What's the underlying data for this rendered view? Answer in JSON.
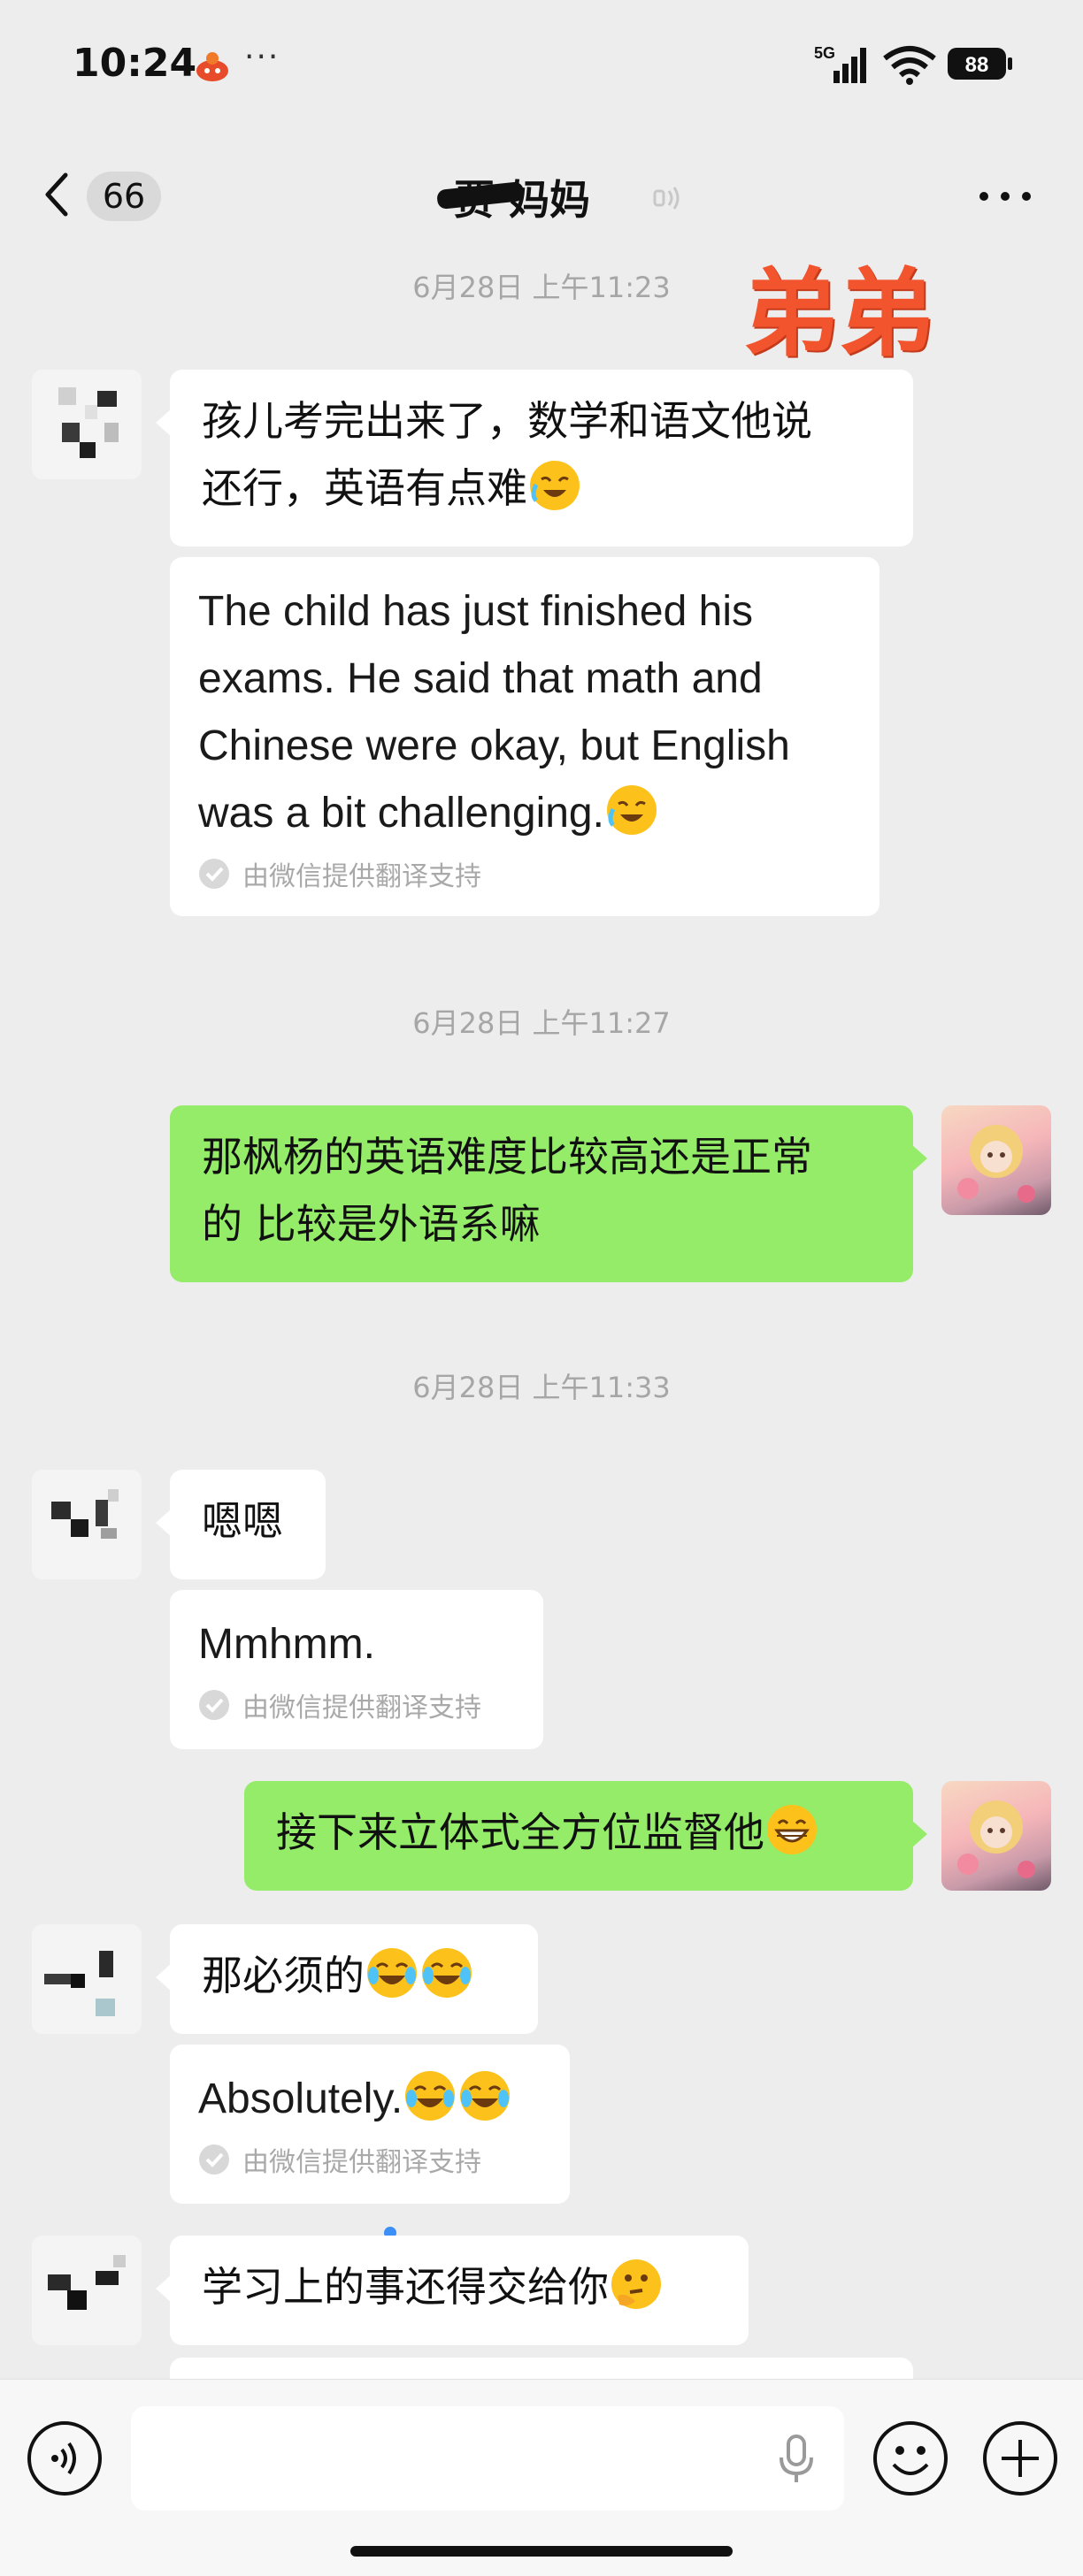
{
  "status_bar": {
    "time": "10:24",
    "more": "···",
    "network": "5G",
    "battery": "88"
  },
  "nav": {
    "back_count": "66",
    "title": "贾 妈妈"
  },
  "watermark": "弟弟",
  "timestamps": [
    "6月28日 上午11:23",
    "6月28日 上午11:27",
    "6月28日 上午11:33"
  ],
  "messages": [
    {
      "from": "other",
      "text_line1": "孩儿考完出来了，数学和语文他说",
      "text_line2": "还行，英语有点难"
    },
    {
      "from": "other",
      "translation": [
        "The child has just finished his",
        "exams. He said that math and",
        "Chinese were okay, but English",
        "was a bit challenging."
      ]
    },
    {
      "from": "self",
      "text_line1": "那枫杨的英语难度比较高还是正常",
      "text_line2": "的 比较是外语系嘛"
    },
    {
      "from": "other",
      "text": "嗯嗯"
    },
    {
      "from": "other",
      "translation": [
        "Mmhmm."
      ]
    },
    {
      "from": "self",
      "text": "接下来立体式全方位监督他"
    },
    {
      "from": "other",
      "text": "那必须的"
    },
    {
      "from": "other",
      "translation": [
        "Absolutely."
      ]
    },
    {
      "from": "other",
      "text": "学习上的事还得交给你"
    }
  ],
  "translation_note": "由微信提供翻译支持",
  "input": {
    "placeholder": ""
  }
}
